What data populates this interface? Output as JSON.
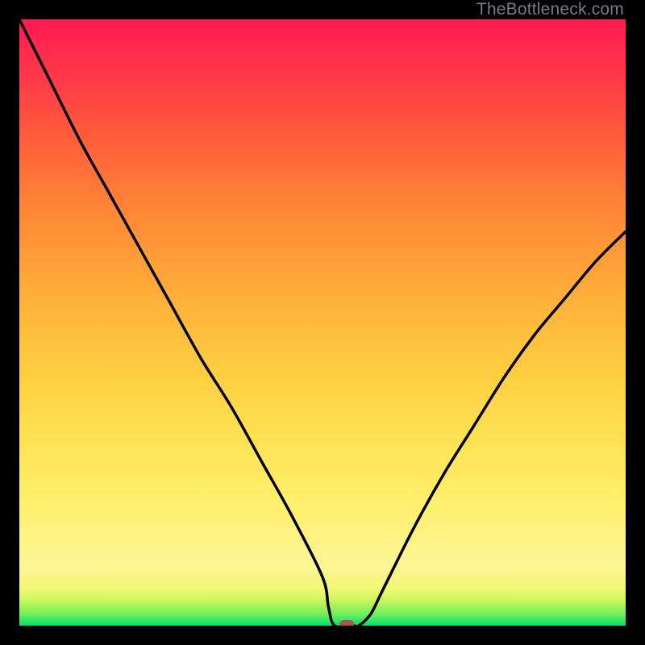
{
  "watermark": "TheBottleneck.com",
  "chart_data": {
    "type": "line",
    "title": "",
    "xlabel": "",
    "ylabel": "",
    "xlim": [
      0,
      100
    ],
    "ylim": [
      0,
      100
    ],
    "grid": false,
    "series": [
      {
        "name": "penalty-curve",
        "x": [
          0,
          5,
          10,
          15,
          20,
          25,
          30,
          35,
          40,
          45,
          50,
          51,
          52,
          55,
          56,
          58,
          60,
          65,
          70,
          75,
          80,
          85,
          90,
          95,
          100
        ],
        "y": [
          100,
          90,
          80,
          71,
          62,
          53,
          44,
          36,
          27,
          18,
          8,
          3,
          0,
          0,
          0,
          2,
          6,
          16,
          25,
          33,
          41,
          48,
          54,
          60,
          65
        ]
      }
    ],
    "marker": {
      "x": 54,
      "y": 0,
      "color": "#b0534e"
    },
    "gradient_stops": [
      {
        "pct": 100,
        "y": "top",
        "color": "#ff1a52"
      },
      {
        "pct": 90,
        "color": "#ff3a48"
      },
      {
        "pct": 80,
        "color": "#ff5f3a"
      },
      {
        "pct": 70,
        "color": "#ff8236"
      },
      {
        "pct": 60,
        "color": "#ff9f38"
      },
      {
        "pct": 50,
        "color": "#ffbb3c"
      },
      {
        "pct": 40,
        "color": "#ffd144"
      },
      {
        "pct": 30,
        "color": "#ffe355"
      },
      {
        "pct": 20,
        "color": "#fff06e"
      },
      {
        "pct": 10,
        "color": "#fdf597"
      },
      {
        "pct": 6,
        "color": "#f1f873"
      },
      {
        "pct": 4,
        "color": "#c4f55a"
      },
      {
        "pct": 2,
        "color": "#76ef5b"
      },
      {
        "pct": 0,
        "y": "bottom",
        "color": "#00e36c"
      }
    ]
  }
}
